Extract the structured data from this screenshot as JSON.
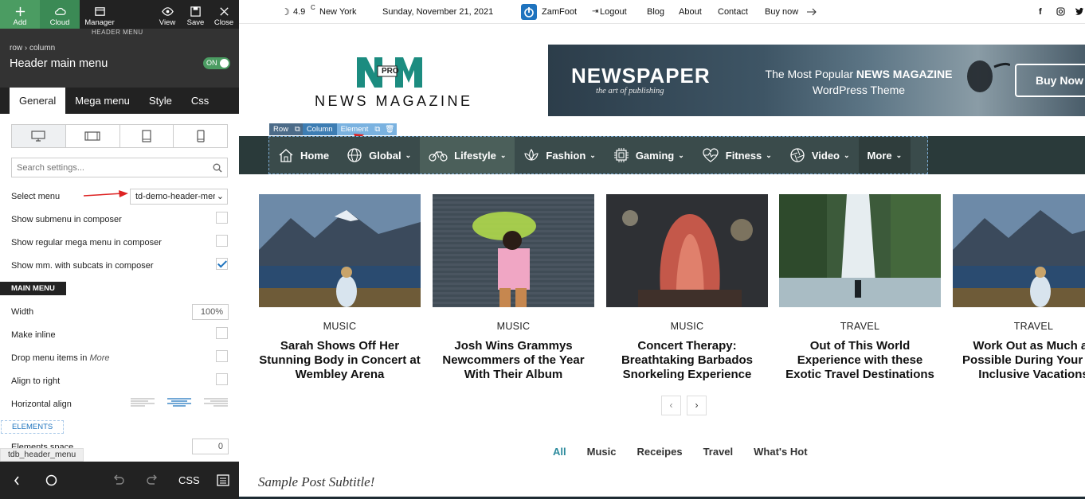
{
  "toolbar": {
    "add": "Add",
    "cloud": "Cloud",
    "manager": "Manager",
    "view": "View",
    "save": "Save",
    "close": "Close"
  },
  "panel": {
    "ghost_label": "HEADER MENU",
    "breadcrumb": "row › column",
    "title": "Header main menu",
    "toggle": "ON",
    "tabs": [
      "General",
      "Mega menu",
      "Style",
      "Css"
    ],
    "search_placeholder": "Search settings...",
    "select_menu_label": "Select menu",
    "select_menu_value": "td-demo-header-menu",
    "show_submenu": "Show submenu in composer",
    "show_regular_mega": "Show regular mega menu in composer",
    "show_mm_subcats": "Show mm. with subcats in composer",
    "section_main_menu": "MAIN MENU",
    "width_label": "Width",
    "width_value": "100%",
    "make_inline": "Make inline",
    "drop_menu_items": "Drop menu items in",
    "drop_menu_items_em": "More",
    "align_right": "Align to right",
    "horizontal_align": "Horizontal align",
    "section_elements": "ELEMENTS",
    "elements_space": "Elements space",
    "elements_space_value": "0",
    "path_tag": "tdb_header_menu",
    "bottom_css": "CSS"
  },
  "site": {
    "topbar": {
      "temp": "4.9",
      "unit": "C",
      "city": "New York",
      "date": "Sunday, November 21, 2021",
      "user": "ZamFoot",
      "logout": "Logout",
      "links": [
        "Blog",
        "About",
        "Contact",
        "Buy now"
      ]
    },
    "logo": {
      "letters": "NM",
      "badge": "PRO",
      "text": "NEWS MAGAZINE"
    },
    "banner": {
      "brand": "NEWSPAPER",
      "tagline": "the art of publishing",
      "promo_pre": "The Most Popular ",
      "promo_bold": "NEWS MAGAZINE",
      "promo_post": "WordPress Theme",
      "button": "Buy Now"
    },
    "composer_crumbs": [
      "Row",
      "Column",
      "Element"
    ],
    "nav": [
      "Home",
      "Global",
      "Lifestyle",
      "Fashion",
      "Gaming",
      "Fitness",
      "Video",
      "More"
    ],
    "posts": [
      {
        "category": "MUSIC",
        "title": "Sarah Shows Off Her Stunning Body in Concert at Wembley Arena"
      },
      {
        "category": "MUSIC",
        "title": "Josh Wins Grammys Newcommers of the Year With Their Album"
      },
      {
        "category": "MUSIC",
        "title": "Concert Therapy: Breathtaking Barbados Snorkeling Experience"
      },
      {
        "category": "TRAVEL",
        "title": "Out of This World Experience with these Exotic Travel Destinations"
      },
      {
        "category": "TRAVEL",
        "title": "Work Out as Much as Possible During Your All-Inclusive Vacations"
      }
    ],
    "pager": {
      "prev": "‹",
      "next": "›"
    },
    "filters": [
      "All",
      "Music",
      "Receipes",
      "Travel",
      "What's Hot"
    ],
    "subtitle": "Sample Post Subtitle!"
  },
  "colors": {
    "accent_green": "#4b9c62",
    "nav_bg": "#2a3a3a",
    "filter_active": "#2b8a9c",
    "logo_teal": "#1c8c80"
  }
}
